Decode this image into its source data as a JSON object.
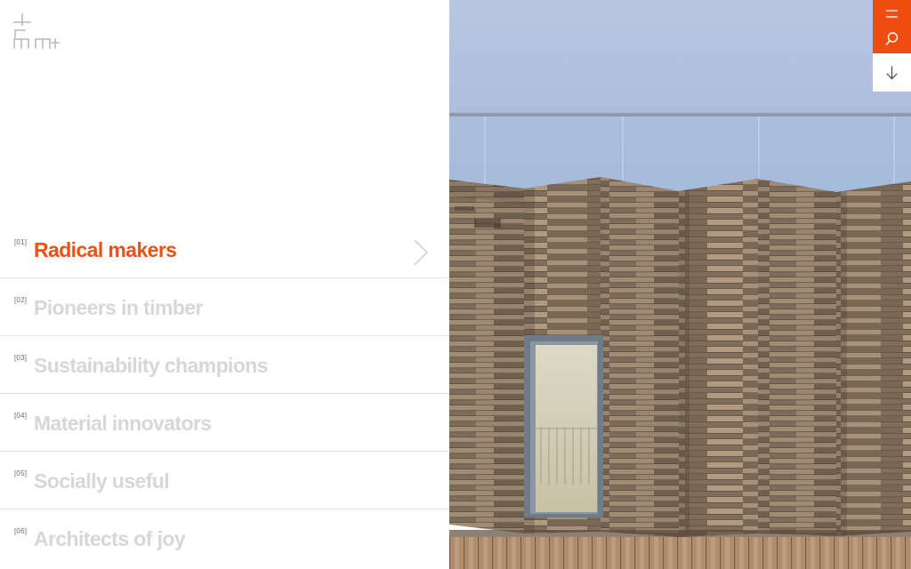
{
  "brand": {
    "logo_icon": "dRMM-logo-icon"
  },
  "nav": {
    "items": [
      {
        "num": "[01]",
        "label": "Radical makers",
        "active": true
      },
      {
        "num": "[02]",
        "label": "Pioneers in timber",
        "active": false
      },
      {
        "num": "[03]",
        "label": "Sustainability champions",
        "active": false
      },
      {
        "num": "[04]",
        "label": "Material innovators",
        "active": false
      },
      {
        "num": "[05]",
        "label": "Socially useful",
        "active": false
      },
      {
        "num": "[06]",
        "label": "Architects of joy",
        "active": false
      }
    ],
    "active_chevron_icon": "chevron-right-icon"
  },
  "controls": {
    "menu_icon": "hamburger-menu-icon",
    "search_icon": "search-icon",
    "scroll_icon": "arrow-down-icon",
    "expand_icon": "expand-icon"
  },
  "colors": {
    "accent": "#ee4f12",
    "inactive_text": "#d7d7d7",
    "divider": "#e2e2e2",
    "background": "#ffffff"
  }
}
